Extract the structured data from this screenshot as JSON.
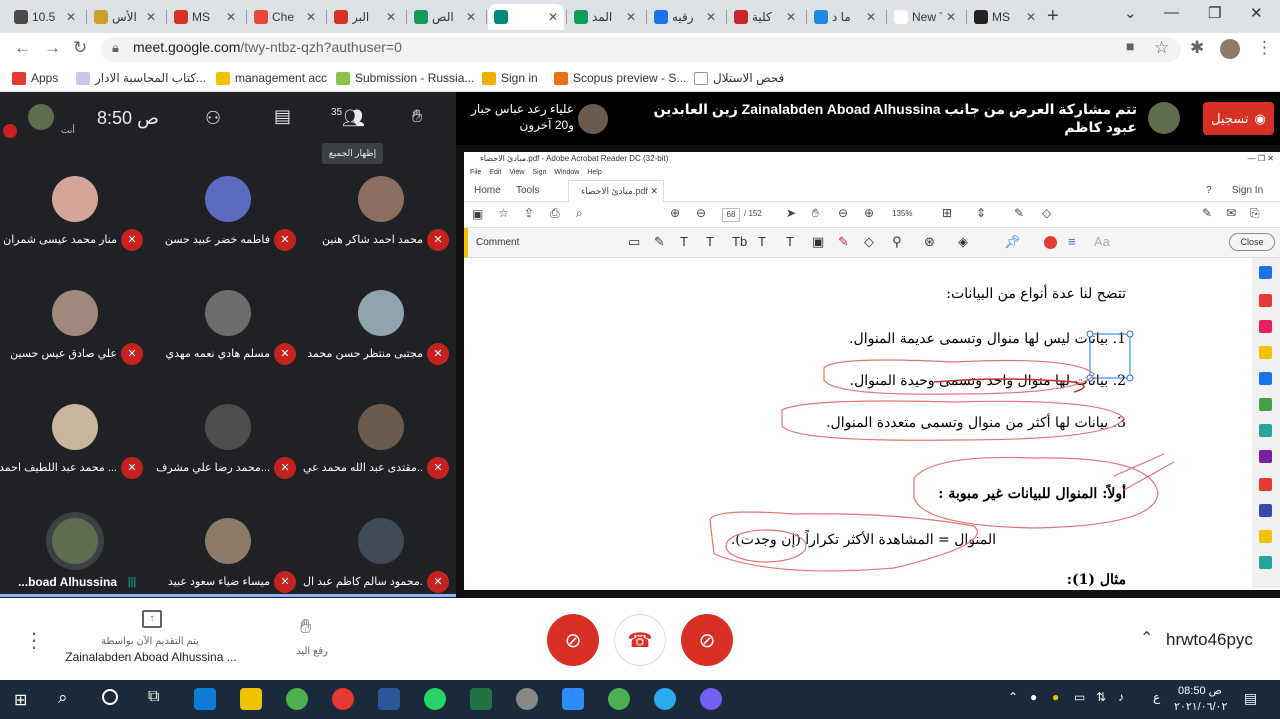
{
  "browser": {
    "tabs": [
      {
        "label": "10.5",
        "color": "#4a4a4a"
      },
      {
        "label": "الأس",
        "color": "#c9a227"
      },
      {
        "label": "MS",
        "color": "#d93025"
      },
      {
        "label": "Che",
        "color": "#e8453c"
      },
      {
        "label": "البر",
        "color": "#d93025"
      },
      {
        "label": "الص",
        "color": "#0f9d58"
      },
      {
        "label": "",
        "color": "#00897b"
      },
      {
        "label": "المد",
        "color": "#0f9d58"
      },
      {
        "label": "رقيه",
        "color": "#1a73e8"
      },
      {
        "label": "كلية",
        "color": "#c62828"
      },
      {
        "label": "ما د",
        "color": "#1e88e5"
      },
      {
        "label": "New Tal",
        "color": "#ffffff"
      },
      {
        "label": "MS",
        "color": "#222"
      }
    ],
    "new_tab": "+",
    "url_host": "meet.google.com",
    "url_path": "/twy-ntbz-qzh?authuser=0"
  },
  "bookmarks": [
    {
      "label": "Apps",
      "color": "#e53935"
    },
    {
      "label": "كتاب المحاسبة الادار...",
      "color": "#c5cae9"
    },
    {
      "label": "management acc",
      "color": "#f2c200"
    },
    {
      "label": "Submission - Russia...",
      "color": "#8bc34a"
    },
    {
      "label": "Sign in",
      "color": "#f0b000"
    },
    {
      "label": "Scopus preview - S...",
      "color": "#e8711a"
    },
    {
      "label": "فحص الاستلال",
      "color": "#ffffff"
    }
  ],
  "meet": {
    "self_label": "أنت",
    "clock": "8:50",
    "clock_suffix": "ص",
    "people_count": "35",
    "tooltip": "إظهار الجميع",
    "banner_user": "علياء رعد عباس جبار و20 آخرون",
    "presenting_text": "تتم مشاركة العرض من جانب Zainalabden Aboad Alhussina زين العابدين عبود كاظم",
    "record_label": "تسجيل",
    "meeting_code": "hrwto46pyc",
    "presenting_now": "يتم التقديم الآن بواسطة",
    "presenter_name": "Zainalabden Aboad Alhussina ...",
    "raise_hand": "رفع اليد",
    "participants": [
      {
        "name": "محمد احمد شاكر هنين",
        "color": "#8d6e63"
      },
      {
        "name": "فاطمه خضر عبيد حسن",
        "color": "#5c6bc0"
      },
      {
        "name": "منار محمد عيسى شمران",
        "color": "#d7a49a"
      },
      {
        "name": "مجتبى منتظر حسن محمد",
        "color": "#90a4ae"
      },
      {
        "name": "مسلم هادي نعمه مهدي",
        "color": "#6d6d6d"
      },
      {
        "name": "علي صادق عيس حسين",
        "color": "#a1887f"
      },
      {
        "name": "مقتدى عبد الله محمد عي...",
        "color": "#6b5a4e"
      },
      {
        "name": "محمد رضا علي مشرف...",
        "color": "#4e4e4e"
      },
      {
        "name": "محمد عبد اللطيف احمد ...",
        "color": "#c9b79c"
      },
      {
        "name": "محمود سالم كاظم عبد ال...",
        "color": "#3e4a55"
      },
      {
        "name": "ميساء ضياء سعود عبيد",
        "color": "#8d7b6a"
      },
      {
        "name": "...boad Alhussina",
        "color": "#5d6d4e"
      }
    ]
  },
  "reader": {
    "title": "مبادئ الاحصاء.pdf - Adobe Acrobat Reader DC (32-bit)",
    "menu": [
      "File",
      "Edit",
      "View",
      "Sign",
      "Window",
      "Help"
    ],
    "tab_home": "Home",
    "tab_tools": "Tools",
    "tab_doc": "مبادئ الاحصاء.pdf",
    "sign_in": "Sign In",
    "page_current": "68",
    "page_total": "/ 152",
    "zoom": "135%",
    "comment_label": "Comment",
    "close_label": "Close",
    "doc_lines": [
      "تتضح لنا عدة أنواع من البيانات:",
      "1. بيانات ليس لها منوال وتسمى عديمة المنوال.",
      "2. بيانات لها منوال واحد وتسمى وحيدة المنوال.",
      "3. بيانات لها أكثر من منوال وتسمى متعددة المنوال.",
      "أولاً: المنوال للبيانات غير مبوبة :",
      "المنوال = المشاهدة الأكثر تكراراً (إن وجدت).",
      "مثال (1):"
    ]
  },
  "taskbar": {
    "time": "08:50",
    "time_suffix": "ص",
    "date": "٢٠٢١/٠٦/٠٢",
    "lang": "ع"
  }
}
